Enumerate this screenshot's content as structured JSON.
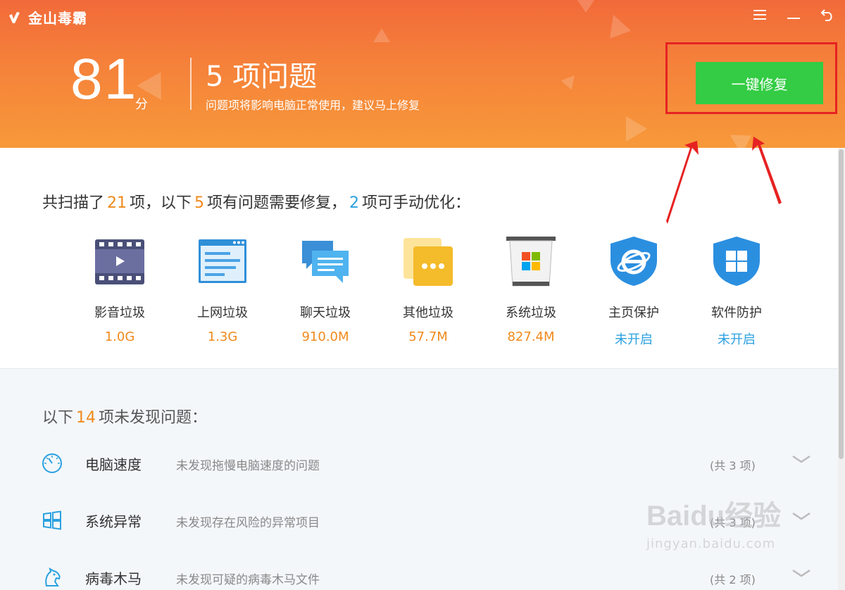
{
  "app": {
    "title": "金山毒霸"
  },
  "window_controls": {
    "menu": "☰",
    "minimize": "—",
    "back": "↶"
  },
  "header": {
    "score": "81",
    "score_unit": "分",
    "issue_title": "5 项问题",
    "issue_subtitle": "问题项将影响电脑正常使用，建议马上修复",
    "fix_button": "一键修复"
  },
  "scan_summary": {
    "p1": "共扫描了",
    "total": "21",
    "p2": "项，以下",
    "problems": "5",
    "p3": "项有问题需要修复，",
    "manual": "2",
    "p4": "项可手动优化："
  },
  "items": [
    {
      "label": "影音垃圾",
      "value": "1.0G",
      "icon": "film-icon",
      "value_color": "orange"
    },
    {
      "label": "上网垃圾",
      "value": "1.3G",
      "icon": "browser-window-icon",
      "value_color": "orange"
    },
    {
      "label": "聊天垃圾",
      "value": "910.0M",
      "icon": "chat-bubbles-icon",
      "value_color": "orange"
    },
    {
      "label": "其他垃圾",
      "value": "57.7M",
      "icon": "folder-more-icon",
      "value_color": "orange"
    },
    {
      "label": "系统垃圾",
      "value": "827.4M",
      "icon": "windows-trash-icon",
      "value_color": "orange"
    },
    {
      "label": "主页保护",
      "value": "未开启",
      "icon": "ie-shield-icon",
      "value_color": "blue"
    },
    {
      "label": "软件防护",
      "value": "未开启",
      "icon": "windows-shield-icon",
      "value_color": "blue"
    }
  ],
  "ok_summary": {
    "p1": "以下",
    "count": "14",
    "p2": "项未发现问题："
  },
  "rows": [
    {
      "name": "电脑速度",
      "desc": "未发现拖慢电脑速度的问题",
      "count": "(共 3 项)",
      "icon": "speedometer-icon"
    },
    {
      "name": "系统异常",
      "desc": "未发现存在风险的异常项目",
      "count": "(共 3 项)",
      "icon": "windows-logo-icon"
    },
    {
      "name": "病毒木马",
      "desc": "未发现可疑的病毒木马文件",
      "count": "(共 2 项)",
      "icon": "trojan-horse-icon"
    }
  ],
  "watermark": {
    "brand": "Baidu经验",
    "url": "jingyan.baidu.com"
  },
  "colors": {
    "header_top": "#f26a3a",
    "header_bottom": "#f7993a",
    "fix_button": "#33cc44",
    "highlight_orange": "#f08a1c",
    "highlight_blue": "#2aa1e0",
    "annotation_red": "#e62222"
  }
}
